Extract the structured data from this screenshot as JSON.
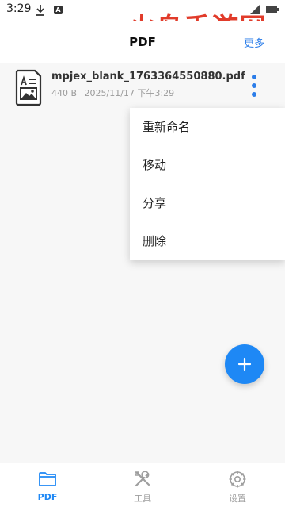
{
  "status_bar": {
    "time": "3:29",
    "a_label": "A"
  },
  "watermark": "火鸟手游网",
  "header": {
    "title": "PDF",
    "more_label": "更多"
  },
  "file": {
    "name": "mpjex_blank_1763364550880.pdf",
    "size": "440 B",
    "date": "2025/11/17 下午3:29"
  },
  "context_menu": {
    "items": [
      {
        "label": "重新命名"
      },
      {
        "label": "移动"
      },
      {
        "label": "分享"
      },
      {
        "label": "删除"
      }
    ]
  },
  "bottom_nav": {
    "items": [
      {
        "label": "PDF",
        "icon": "folder-icon",
        "active": true
      },
      {
        "label": "工具",
        "icon": "tools-icon",
        "active": false
      },
      {
        "label": "设置",
        "icon": "settings-icon",
        "active": false
      }
    ]
  },
  "colors": {
    "accent": "#1e88f5",
    "link": "#2b7de9",
    "watermark": "#e0311f"
  }
}
